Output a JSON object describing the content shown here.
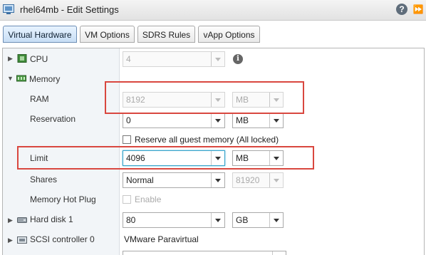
{
  "window": {
    "title": "rhel64mb - Edit Settings",
    "help_icon": "?",
    "more_icon": "⏩"
  },
  "tabs": [
    {
      "label": "Virtual Hardware",
      "active": true
    },
    {
      "label": "VM Options"
    },
    {
      "label": "SDRS Rules"
    },
    {
      "label": "vApp Options"
    }
  ],
  "cpu": {
    "label": "CPU",
    "value": "4"
  },
  "memory": {
    "label": "Memory",
    "ram": {
      "label": "RAM",
      "value": "8192",
      "unit": "MB"
    },
    "reservation": {
      "label": "Reservation",
      "value": "0",
      "unit": "MB",
      "checkbox_label": "Reserve all guest memory (All locked)"
    },
    "limit": {
      "label": "Limit",
      "value": "4096",
      "unit": "MB"
    },
    "shares": {
      "label": "Shares",
      "value": "Normal",
      "amount": "81920"
    },
    "hot_plug": {
      "label": "Memory Hot Plug",
      "checkbox_label": "Enable"
    }
  },
  "hard_disk": {
    "label": "Hard disk 1",
    "value": "80",
    "unit": "GB"
  },
  "scsi": {
    "label": "SCSI controller 0",
    "value": "VMware Paravirtual"
  },
  "colors": {
    "highlight": "#d9473f",
    "focus": "#35a3c9",
    "active_tab": "#c7def5"
  }
}
